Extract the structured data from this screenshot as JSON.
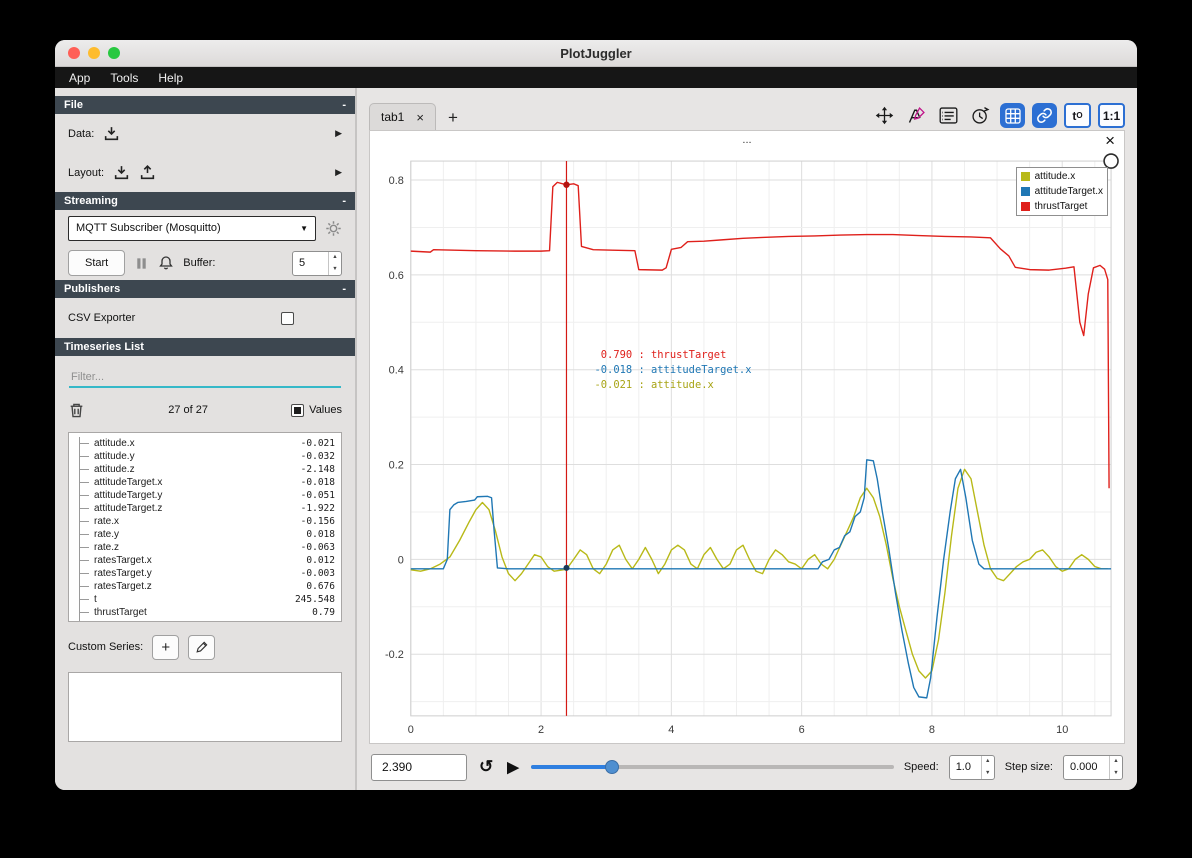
{
  "window": {
    "title": "PlotJuggler",
    "menu": [
      "App",
      "Tools",
      "Help"
    ]
  },
  "glyphs": {
    "collapse": "-",
    "expand": "▶",
    "combo_arrow": "▼",
    "close": "×",
    "add": "+",
    "loop": "↺",
    "play": "▶",
    "up": "▲",
    "down": "▼"
  },
  "sidebar": {
    "file": {
      "title": "File",
      "data_label": "Data:",
      "layout_label": "Layout:"
    },
    "streaming": {
      "title": "Streaming",
      "source": "MQTT Subscriber (Mosquitto)",
      "start_label": "Start",
      "buffer_label": "Buffer:",
      "buffer_value": "5"
    },
    "publishers": {
      "title": "Publishers",
      "csv_label": "CSV Exporter"
    },
    "timeseries": {
      "title": "Timeseries List",
      "filter_placeholder": "Filter...",
      "count": "27 of 27",
      "values_label": "Values",
      "custom_label": "Custom Series:",
      "items": [
        {
          "name": "attitude.x",
          "value": "-0.021"
        },
        {
          "name": "attitude.y",
          "value": "-0.032"
        },
        {
          "name": "attitude.z",
          "value": "-2.148"
        },
        {
          "name": "attitudeTarget.x",
          "value": "-0.018"
        },
        {
          "name": "attitudeTarget.y",
          "value": "-0.051"
        },
        {
          "name": "attitudeTarget.z",
          "value": "-1.922"
        },
        {
          "name": "rate.x",
          "value": "-0.156"
        },
        {
          "name": "rate.y",
          "value": "0.018"
        },
        {
          "name": "rate.z",
          "value": "-0.063"
        },
        {
          "name": "ratesTarget.x",
          "value": "0.012"
        },
        {
          "name": "ratesTarget.y",
          "value": "-0.003"
        },
        {
          "name": "ratesTarget.z",
          "value": "0.676"
        },
        {
          "name": "t",
          "value": "245.548"
        },
        {
          "name": "thrustTarget",
          "value": "0.79"
        }
      ]
    }
  },
  "main": {
    "tab_label": "tab1",
    "toolbar": {
      "t0_base": "t",
      "t0_sub": "O",
      "ratio": "1:1"
    },
    "plot": {
      "title": "...",
      "legend": [
        {
          "label": "attitude.x",
          "color": "#b8b918"
        },
        {
          "label": "attitudeTarget.x",
          "color": "#1f77b4"
        },
        {
          "label": "thrustTarget",
          "color": "#df201b"
        }
      ],
      "tracker_readouts": [
        {
          "value": "0.790",
          "label": "thrustTarget",
          "color": "#df201b"
        },
        {
          "value": "-0.018",
          "label": "attitudeTarget.x",
          "color": "#1f77b4"
        },
        {
          "value": "-0.021",
          "label": "attitude.x",
          "color": "#a8a415"
        }
      ]
    },
    "playback": {
      "time": "2.390",
      "speed_label": "Speed:",
      "speed_value": "1.0",
      "step_label": "Step size:",
      "step_value": "0.000"
    }
  },
  "chart_data": {
    "type": "line",
    "title": "...",
    "xlabel": "",
    "ylabel": "",
    "xlim": [
      0,
      10.75
    ],
    "ylim": [
      -0.33,
      0.84
    ],
    "x_ticks": [
      0,
      2,
      4,
      6,
      8,
      10
    ],
    "y_ticks": [
      -0.2,
      0,
      0.2,
      0.4,
      0.6,
      0.8
    ],
    "grid": true,
    "legend_position": "top-right",
    "tracker_x": 2.39,
    "series": [
      {
        "name": "attitude.x",
        "color": "#b8b918",
        "x": [
          0,
          0.15,
          0.3,
          0.45,
          0.6,
          0.75,
          0.9,
          1.0,
          1.1,
          1.2,
          1.3,
          1.4,
          1.5,
          1.6,
          1.7,
          1.8,
          1.9,
          2.0,
          2.1,
          2.2,
          2.39,
          2.5,
          2.6,
          2.7,
          2.8,
          2.9,
          3.0,
          3.1,
          3.2,
          3.3,
          3.4,
          3.5,
          3.6,
          3.7,
          3.8,
          3.9,
          4.0,
          4.1,
          4.2,
          4.3,
          4.4,
          4.5,
          4.6,
          4.7,
          4.8,
          4.9,
          5.0,
          5.1,
          5.2,
          5.3,
          5.4,
          5.5,
          5.6,
          5.7,
          5.8,
          5.9,
          6.0,
          6.1,
          6.2,
          6.3,
          6.4,
          6.5,
          6.6,
          6.7,
          6.8,
          6.9,
          7.0,
          7.1,
          7.2,
          7.3,
          7.4,
          7.5,
          7.6,
          7.7,
          7.8,
          7.9,
          8.0,
          8.1,
          8.2,
          8.3,
          8.4,
          8.5,
          8.6,
          8.7,
          8.8,
          8.9,
          9.0,
          9.1,
          9.2,
          9.3,
          9.4,
          9.5,
          9.6,
          9.7,
          9.8,
          9.9,
          10.0,
          10.1,
          10.2,
          10.3,
          10.4,
          10.5,
          10.6,
          10.7
        ],
        "y": [
          -0.022,
          -0.025,
          -0.02,
          -0.01,
          0.005,
          0.04,
          0.08,
          0.105,
          0.12,
          0.105,
          0.06,
          0.005,
          -0.03,
          -0.045,
          -0.03,
          -0.01,
          0.01,
          0.005,
          -0.015,
          -0.025,
          -0.021,
          0.0,
          0.02,
          0.01,
          -0.02,
          -0.03,
          -0.01,
          0.02,
          0.03,
          0.0,
          -0.02,
          0.0,
          0.025,
          0.0,
          -0.03,
          -0.01,
          0.02,
          0.03,
          0.02,
          -0.01,
          -0.02,
          0.01,
          0.025,
          0.0,
          -0.02,
          -0.01,
          0.02,
          0.03,
          0.0,
          -0.025,
          -0.03,
          0.0,
          0.02,
          0.01,
          -0.005,
          -0.01,
          -0.02,
          0.0,
          0.01,
          -0.01,
          -0.02,
          0.0,
          0.03,
          0.06,
          0.09,
          0.13,
          0.15,
          0.13,
          0.09,
          0.03,
          -0.04,
          -0.1,
          -0.15,
          -0.2,
          -0.235,
          -0.25,
          -0.235,
          -0.17,
          -0.07,
          0.05,
          0.15,
          0.19,
          0.17,
          0.1,
          0.03,
          -0.02,
          -0.04,
          -0.045,
          -0.03,
          -0.015,
          -0.005,
          0.0,
          0.015,
          0.02,
          0.005,
          -0.015,
          -0.025,
          -0.02,
          0.0,
          0.01,
          0.0,
          -0.015,
          -0.02,
          -0.02
        ]
      },
      {
        "name": "attitudeTarget.x",
        "color": "#1f77b4",
        "x": [
          0,
          0.5,
          0.56,
          0.6,
          0.66,
          0.72,
          0.85,
          0.98,
          1.02,
          1.18,
          1.24,
          1.28,
          1.33,
          1.5,
          2.5,
          3.5,
          4.5,
          5.5,
          6.25,
          6.32,
          6.42,
          6.5,
          6.58,
          6.66,
          6.74,
          6.82,
          6.9,
          6.96,
          7.0,
          7.1,
          7.16,
          7.24,
          7.34,
          7.44,
          7.54,
          7.64,
          7.72,
          7.8,
          7.92,
          7.98,
          8.08,
          8.18,
          8.28,
          8.36,
          8.44,
          8.52,
          8.62,
          8.72,
          8.8,
          9.5,
          10.75
        ],
        "y": [
          -0.02,
          -0.02,
          0.0,
          0.105,
          0.115,
          0.12,
          0.122,
          0.125,
          0.132,
          0.133,
          0.13,
          0.06,
          -0.018,
          -0.02,
          -0.02,
          -0.02,
          -0.02,
          -0.02,
          -0.02,
          -0.005,
          0.0,
          0.02,
          0.025,
          0.05,
          0.058,
          0.09,
          0.1,
          0.13,
          0.21,
          0.208,
          0.17,
          0.1,
          0.02,
          -0.07,
          -0.15,
          -0.22,
          -0.27,
          -0.29,
          -0.292,
          -0.25,
          -0.12,
          0.0,
          0.1,
          0.17,
          0.19,
          0.13,
          0.04,
          -0.01,
          -0.02,
          -0.02,
          -0.02
        ]
      },
      {
        "name": "thrustTarget",
        "color": "#df201b",
        "x": [
          0,
          0.3,
          0.35,
          1.0,
          1.6,
          2.0,
          2.13,
          2.18,
          2.25,
          2.39,
          2.5,
          2.57,
          2.62,
          2.8,
          3.1,
          3.44,
          3.5,
          3.86,
          3.92,
          4.0,
          4.15,
          4.25,
          4.5,
          4.8,
          5.1,
          5.4,
          5.8,
          6.2,
          6.6,
          7.0,
          7.4,
          7.8,
          8.2,
          8.6,
          8.9,
          9.05,
          9.18,
          9.28,
          9.5,
          9.8,
          10.05,
          10.18,
          10.27,
          10.33,
          10.4,
          10.48,
          10.58,
          10.65,
          10.7,
          10.72
        ],
        "y": [
          0.65,
          0.648,
          0.653,
          0.651,
          0.65,
          0.65,
          0.651,
          0.786,
          0.795,
          0.79,
          0.792,
          0.788,
          0.66,
          0.653,
          0.652,
          0.651,
          0.611,
          0.61,
          0.615,
          0.654,
          0.658,
          0.67,
          0.671,
          0.674,
          0.677,
          0.679,
          0.681,
          0.682,
          0.684,
          0.685,
          0.685,
          0.683,
          0.681,
          0.68,
          0.678,
          0.655,
          0.64,
          0.616,
          0.611,
          0.61,
          0.614,
          0.617,
          0.5,
          0.472,
          0.56,
          0.615,
          0.62,
          0.612,
          0.59,
          0.15
        ]
      }
    ]
  }
}
